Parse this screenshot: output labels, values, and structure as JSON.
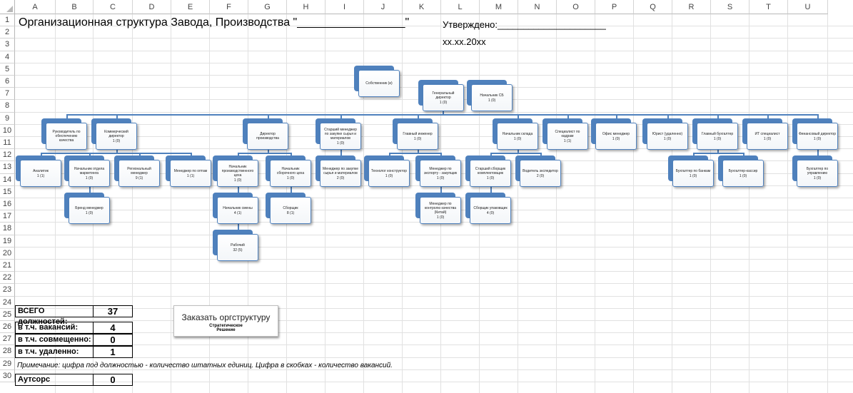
{
  "sheet": {
    "columns": [
      "A",
      "B",
      "C",
      "D",
      "E",
      "F",
      "G",
      "H",
      "I",
      "J",
      "K",
      "L",
      "M",
      "N",
      "O",
      "P",
      "Q",
      "R",
      "S",
      "T",
      "U"
    ],
    "rows": [
      "1",
      "2",
      "3",
      "4",
      "5",
      "6",
      "7",
      "8",
      "9",
      "10",
      "11",
      "12",
      "13",
      "14",
      "15",
      "16",
      "17",
      "18",
      "19",
      "20",
      "21",
      "22",
      "23",
      "24",
      "25",
      "26",
      "27",
      "28",
      "29",
      "30"
    ]
  },
  "header": {
    "title": "Организационная структура Завода, Производства \"_________________\"",
    "approved": "Утверждено:_____________________",
    "date": "xx.xx.20xx"
  },
  "org": {
    "owner": {
      "name": "Собственник (и)",
      "count": ""
    },
    "gd": {
      "name": "Генеральный директор",
      "count": "1 (0)"
    },
    "sb": {
      "name": "Начальник СБ",
      "count": "1 (0)"
    },
    "n1": {
      "name": "Руководитель по обеспечению качества",
      "count": ""
    },
    "n2": {
      "name": "Коммерческий директор",
      "count": "1 (0)"
    },
    "n3": {
      "name": "Директор производства",
      "count": ""
    },
    "n4": {
      "name": "Старший менеджер по закупке сырья и материалов",
      "count": "1 (0)"
    },
    "n5": {
      "name": "Главный инженер",
      "count": "1 (0)"
    },
    "n6": {
      "name": "Начальник склада",
      "count": "1 (0)"
    },
    "n7": {
      "name": "Специалист по кадрам",
      "count": "1 (1)"
    },
    "n8": {
      "name": "Офис менеджер",
      "count": "1 (0)"
    },
    "n9": {
      "name": "Юрист (удаленно)",
      "count": "1 (0)"
    },
    "n10": {
      "name": "Главный бухгалтер",
      "count": "1 (0)"
    },
    "n11": {
      "name": "ИТ специалист",
      "count": "1 (0)"
    },
    "n12": {
      "name": "Финансовый директор",
      "count": "1 (0)"
    },
    "analyst": {
      "name": "Аналитик",
      "count": "1 (1)"
    },
    "marketing": {
      "name": "Начальник отдела маркетинга",
      "count": "1 (0)"
    },
    "regional": {
      "name": "Региональный менеджер",
      "count": "9 (1)"
    },
    "wholesale": {
      "name": "Менеджер по оптам",
      "count": "1 (1)"
    },
    "prodhead": {
      "name": "Начальник производственного цеха",
      "count": "1 (0)"
    },
    "assemblyhead": {
      "name": "Начальник сборочного цеха",
      "count": "1 (0)"
    },
    "buyer": {
      "name": "Менеджер по закупке сырья и материалов",
      "count": "2 (0)"
    },
    "technologist": {
      "name": "Технолог конструктор",
      "count": "1 (0)"
    },
    "exportmgr": {
      "name": "Менеджер по экспорту - закупщик",
      "count": "1 (0)"
    },
    "seniorassembler": {
      "name": "Старший сборщик комплектовщик",
      "count": "1 (0)"
    },
    "driver": {
      "name": "Водитель экспедитор",
      "count": "2 (0)"
    },
    "bankacc": {
      "name": "Бухгалтер по банкам",
      "count": "1 (0)"
    },
    "cashacc": {
      "name": "Бухгалтер-кассир",
      "count": "1 (0)"
    },
    "mgmtacc": {
      "name": "Бухгалтер по управлению",
      "count": "1 (0)"
    },
    "brand": {
      "name": "Бренд менеджер",
      "count": "1 (0)"
    },
    "shift": {
      "name": "Начальник смены",
      "count": "4 (1)"
    },
    "assembler": {
      "name": "Сборщик",
      "count": "8 (1)"
    },
    "quality": {
      "name": "Менеджер по контролю качества (Китай)",
      "count": "1 (0)"
    },
    "packer": {
      "name": "Сборщик упаковщик",
      "count": "4 (0)"
    },
    "worker": {
      "name": "Рабочий",
      "count": "32 (5)"
    }
  },
  "summary": {
    "total_label": "ВСЕГО должностей:",
    "total_value": "37",
    "vacancies_label": "в т.ч. вакансий:",
    "vacancies_value": "4",
    "combined_label": "в т.ч. совмещенно:",
    "combined_value": "0",
    "remote_label": "в т.ч. удаленно:",
    "remote_value": "1",
    "note": "Примечание: цифра под должностью - количество штатных единиц. Цифра в скобках - количество вакансий.",
    "outsource_label": "Аутсорс",
    "outsource_value": "0"
  },
  "order_button": {
    "label": "Заказать оргструктуру",
    "sub1": "Стратегическое",
    "sub2": "Решение"
  },
  "colors": {
    "accent": "#4f81bd",
    "grid": "#e1e1e1"
  }
}
